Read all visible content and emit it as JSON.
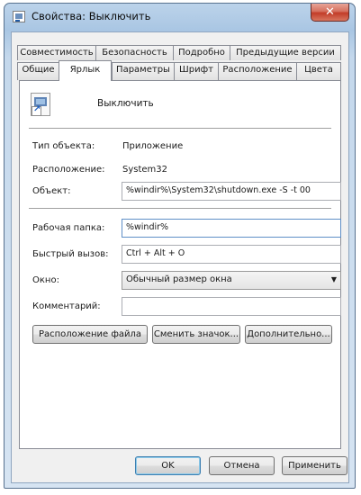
{
  "window": {
    "title": "Свойства: Выключить",
    "close_label": "✕"
  },
  "tabs_row1": [
    {
      "label": "Совместимость"
    },
    {
      "label": "Безопасность"
    },
    {
      "label": "Подробно"
    },
    {
      "label": "Предыдущие версии"
    }
  ],
  "tabs_row2": [
    {
      "label": "Общие"
    },
    {
      "label": "Ярлык",
      "active": true
    },
    {
      "label": "Параметры"
    },
    {
      "label": "Шрифт"
    },
    {
      "label": "Расположение"
    },
    {
      "label": "Цвета"
    }
  ],
  "shortcut": {
    "name": "Выключить",
    "type_label": "Тип объекта:",
    "type_value": "Приложение",
    "location_label": "Расположение:",
    "location_value": "System32",
    "target_label": "Объект:",
    "target_value": "%windir%\\System32\\shutdown.exe -S -t 00",
    "startin_label": "Рабочая папка:",
    "startin_value": "%windir%",
    "hotkey_label": "Быстрый вызов:",
    "hotkey_value": "Ctrl + Alt + O",
    "window_label": "Окно:",
    "window_value": "Обычный размер окна",
    "comment_label": "Комментарий:",
    "comment_value": ""
  },
  "action_buttons": {
    "open_location": "Расположение файла",
    "change_icon": "Сменить значок...",
    "advanced": "Дополнительно..."
  },
  "dialog_buttons": {
    "ok": "OK",
    "cancel": "Отмена",
    "apply": "Применить"
  }
}
